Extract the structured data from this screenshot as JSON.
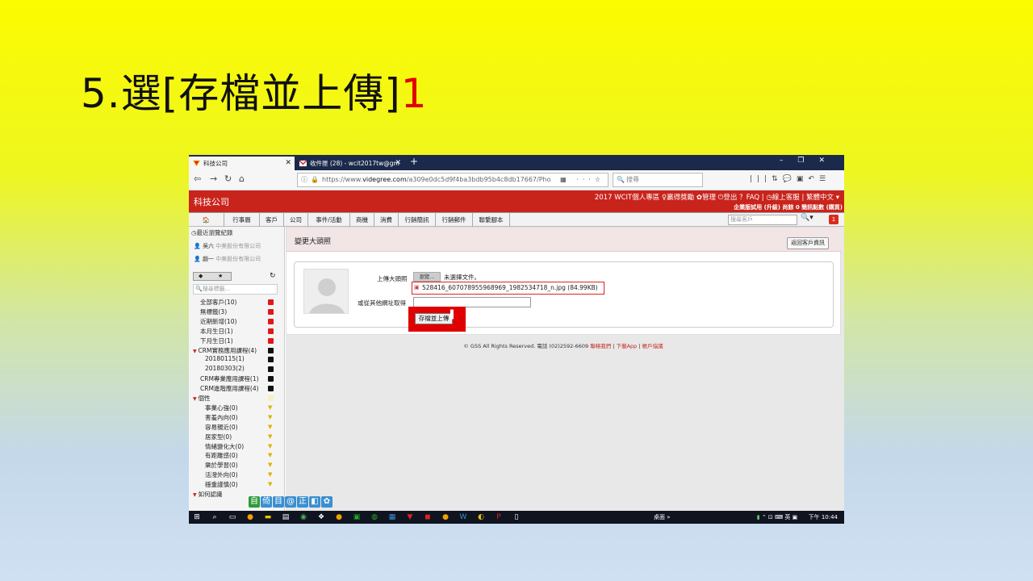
{
  "slide": {
    "title": "5.選[存檔並上傳]",
    "title_num": "1"
  },
  "browser": {
    "tabs": [
      {
        "label": "科技公司",
        "close": "✕"
      },
      {
        "label": "收件匣 (28) - wcit2017tw@gm",
        "close": "✕"
      }
    ],
    "new_tab": "+",
    "url_prefix": "https://www.",
    "url_domain": "videgree.com",
    "url_path": "/a309e0dc5d9f4ba3bdb95b4c8db17667/Pho",
    "search_placeholder": "搜尋"
  },
  "app": {
    "brand": "科技公司",
    "top_links": "2017 WCIT個人專區  ♀贏得獎勵  ✿管理  ⏻登出  ？FAQ  |  ◷線上客服  |  繁體中文 ▾",
    "sub_info": "企業版試用 (升級)  尚餘 0 簡訊點數 (購買)",
    "menu": [
      "🏠",
      "行事曆",
      "客戶",
      "公司",
      "事件/活動",
      "商機",
      "消費",
      "行銷簡訊",
      "行銷郵件",
      "聯繫腳本"
    ],
    "menu_search_placeholder": "搜尋客戶",
    "notif_count": "1"
  },
  "sidebar": {
    "recent_header": "最近瀏覽紀錄",
    "recent": [
      {
        "name": "吳六",
        "company": "中美股份有限公司"
      },
      {
        "name": "趙一",
        "company": "中美股份有限公司"
      }
    ],
    "search_placeholder": "搜尋標籤...",
    "items": [
      {
        "label": "全部客戶(10)",
        "type": "cat",
        "mark": "red"
      },
      {
        "label": "無標籤(3)",
        "type": "cat",
        "mark": "red"
      },
      {
        "label": "近期新增(10)",
        "type": "cat",
        "mark": "red"
      },
      {
        "label": "本月生日(1)",
        "type": "cat",
        "mark": "red"
      },
      {
        "label": "下月生日(1)",
        "type": "cat",
        "mark": "red"
      },
      {
        "label": "CRM實務應用課程(4)",
        "type": "head",
        "mark": "blk"
      },
      {
        "label": "20180115(1)",
        "type": "sub",
        "mark": "blk"
      },
      {
        "label": "20180303(2)",
        "type": "sub",
        "mark": "blk"
      },
      {
        "label": "CRM專業應用課程(1)",
        "type": "cat",
        "mark": "blk"
      },
      {
        "label": "CRM進階應用課程(4)",
        "type": "cat",
        "mark": "blk"
      },
      {
        "label": "個性",
        "type": "head",
        "mark": "pale"
      },
      {
        "label": "事業心強(0)",
        "type": "sub",
        "mark": "yel"
      },
      {
        "label": "害羞內向(0)",
        "type": "sub",
        "mark": "yel"
      },
      {
        "label": "容易親近(0)",
        "type": "sub",
        "mark": "yel"
      },
      {
        "label": "居家型(0)",
        "type": "sub",
        "mark": "yel"
      },
      {
        "label": "情緒變化大(0)",
        "type": "sub",
        "mark": "yel"
      },
      {
        "label": "有距離感(0)",
        "type": "sub",
        "mark": "yel"
      },
      {
        "label": "樂於學習(0)",
        "type": "sub",
        "mark": "yel"
      },
      {
        "label": "活潑外向(0)",
        "type": "sub",
        "mark": "yel"
      },
      {
        "label": "穩重謹慎(0)",
        "type": "sub",
        "mark": "yel"
      },
      {
        "label": "如何認識",
        "type": "head",
        "mark": "none"
      }
    ],
    "ime_strip": [
      "自",
      "倚",
      "目",
      "@",
      "正",
      "◧",
      "✿"
    ]
  },
  "page": {
    "title": "變更大頭照",
    "back_button": "返回客戶資訊",
    "upload_label": "上傳大頭照",
    "browse_button": "瀏覽...",
    "no_file": "未選擇文件。",
    "selected_file": "528416_607078955968969_1982534718_n.jpg (84.99KB)",
    "url_label": "或從其他網址取得",
    "save_button": "存檔並上傳",
    "footer_text": "© GSS All Rights Reserved. 電話 (02)2592-6609 ",
    "footer_links": [
      "聯絡我們",
      "下載App",
      "帳戶協議"
    ]
  },
  "taskbar": {
    "search_label": "桌面 »",
    "ime": "英",
    "time": "下午 10:44"
  }
}
